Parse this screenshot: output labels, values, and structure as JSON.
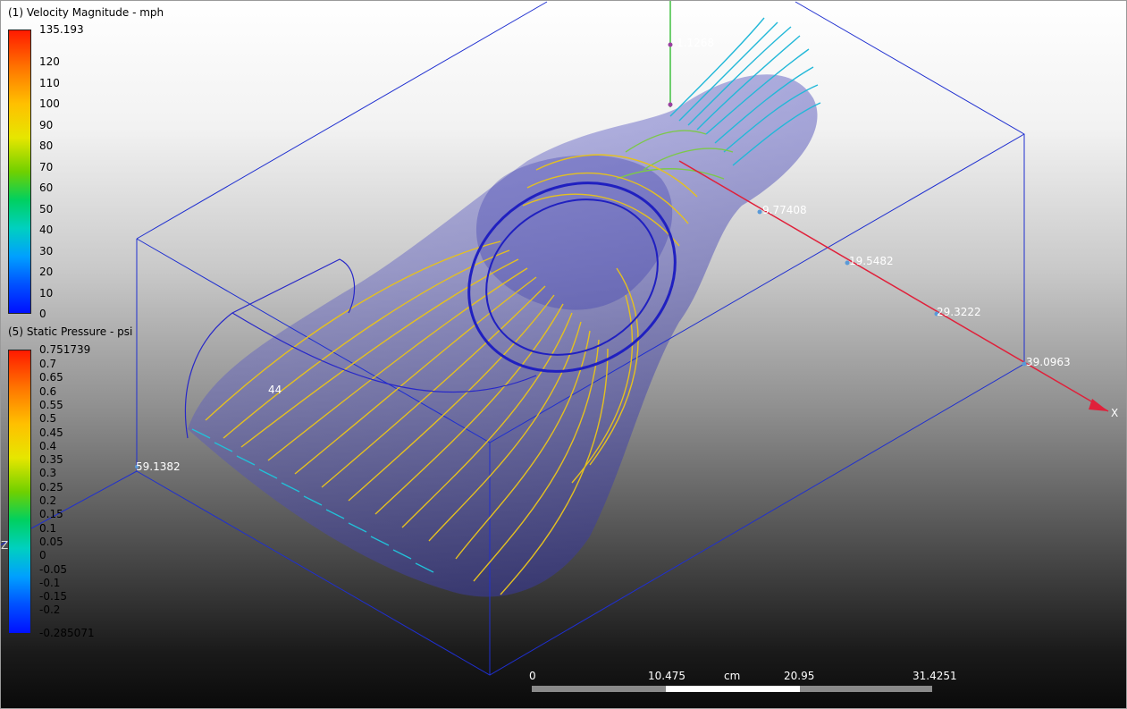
{
  "velocity_legend": {
    "title": "(1) Velocity Magnitude - mph",
    "max_label": "135.193",
    "ticks": [
      "120",
      "110",
      "100",
      "90",
      "80",
      "70",
      "60",
      "50",
      "40",
      "30",
      "20",
      "10",
      "0"
    ]
  },
  "pressure_legend": {
    "title": "(5) Static Pressure - psi",
    "max_label": "0.751739",
    "ticks": [
      "0.7",
      "0.65",
      "0.6",
      "0.55",
      "0.5",
      "0.45",
      "0.4",
      "0.35",
      "0.3",
      "0.25",
      "0.2",
      "0.15",
      "0.1",
      "0.05",
      "0",
      "-0.05",
      "-0.1",
      "-0.15",
      "-0.2"
    ],
    "min_label": "-0.285071"
  },
  "axes": {
    "x_ticks": [
      "9.77408",
      "19.5482",
      "29.3222",
      "39.0963"
    ],
    "x_name": "X",
    "y_tick": "1.1268",
    "z_tick_a": "59.1382",
    "z_tick_b": "44",
    "z_name": "Z"
  },
  "scale_bar": {
    "labels": [
      "0",
      "10.475",
      "cm",
      "20.95",
      "31.4251"
    ]
  },
  "colors": {
    "bounding_box": "#1f2fd0",
    "x_axis": "#e0203a",
    "streamline_main": "#e8c020",
    "streamline_inlet": "#20b8d8"
  }
}
